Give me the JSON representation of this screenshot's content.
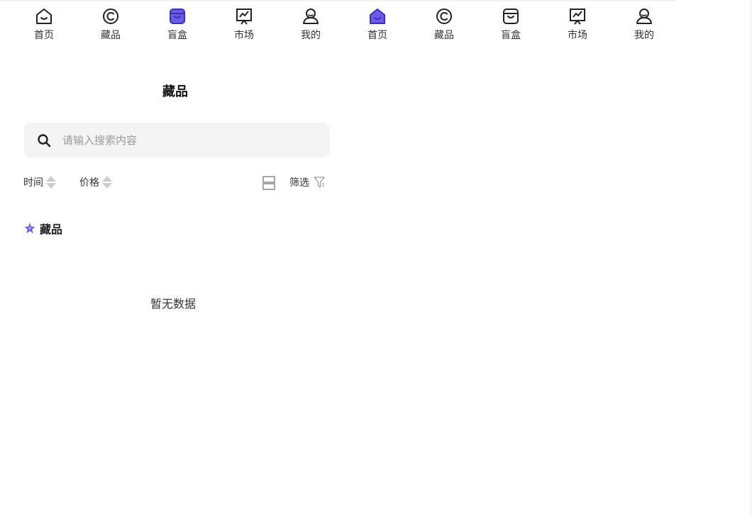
{
  "navbar": {
    "accent": "#6c5ce7",
    "items": [
      {
        "label": "首页",
        "icon": "home-icon",
        "active": false
      },
      {
        "label": "藏品",
        "icon": "copyright-icon",
        "active": false
      },
      {
        "label": "盲盒",
        "icon": "box-icon",
        "active": true
      },
      {
        "label": "市场",
        "icon": "chart-icon",
        "active": false
      },
      {
        "label": "我的",
        "icon": "user-icon",
        "active": false
      },
      {
        "label": "首页",
        "icon": "home-icon",
        "active": true
      },
      {
        "label": "藏品",
        "icon": "copyright-icon",
        "active": false
      },
      {
        "label": "盲盒",
        "icon": "box-icon",
        "active": false
      },
      {
        "label": "市场",
        "icon": "chart-icon",
        "active": false
      },
      {
        "label": "我的",
        "icon": "user-icon",
        "active": false
      }
    ]
  },
  "page": {
    "title": "藏品"
  },
  "search": {
    "placeholder": "请输入搜索内容",
    "value": ""
  },
  "sortbar": {
    "time_label": "时间",
    "price_label": "价格",
    "filter_label": "筛选"
  },
  "section": {
    "title": "藏品",
    "icon": "star-icon"
  },
  "empty": {
    "text": "暂无数据"
  }
}
